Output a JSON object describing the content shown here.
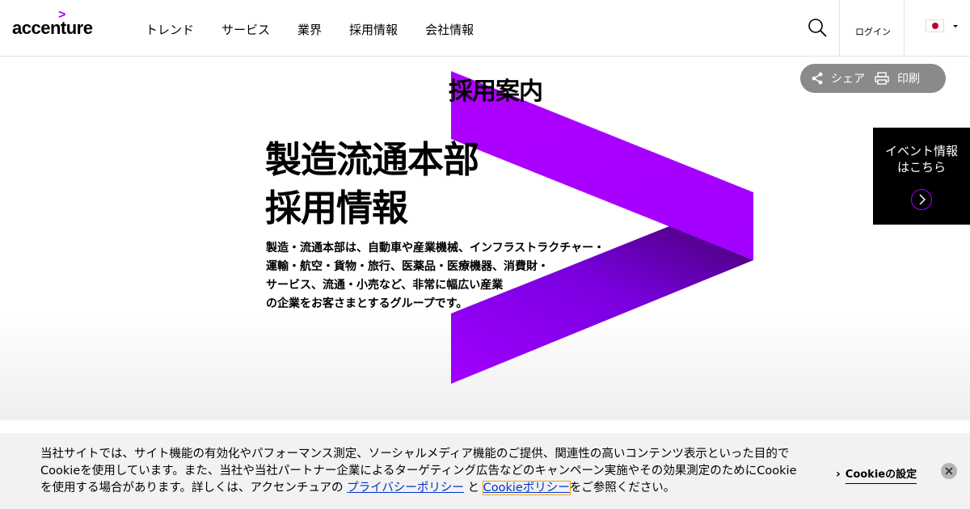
{
  "header": {
    "logo_text": "accenture",
    "logo_mark": ">",
    "nav": [
      "トレンド",
      "サービス",
      "業界",
      "採用情報",
      "会社情報"
    ],
    "login_label": "ログイン"
  },
  "hero": {
    "page_title": "採用案内",
    "heading_line1": "製造流通本部",
    "heading_line2": "採用情報",
    "body_lines": [
      "製造・流通本部は、自動車や産業機械、インフラストラクチャー・",
      "運輸・航空・貨物・旅行、医薬品・医療機器、消費財・",
      "サービス、流通・小売など、非常に幅広い産業",
      "の企業をお客さまとするグループです。"
    ]
  },
  "share_bar": {
    "share_label": "シェア",
    "print_label": "印刷"
  },
  "event": {
    "line1": "イベント情報",
    "line2": "はこちら"
  },
  "cookie": {
    "text_before": "当社サイトでは、サイト機能の有効化やパフォーマンス測定、ソーシャルメディア機能のご提供、関連性の高いコンテンツ表示といった目的でCookieを使用しています。また、当社や当社パートナー企業によるターゲティング広告などのキャンペーン実施やその効果測定のためにCookieを使用する場合があります。詳しくは、アクセンチュアの ",
    "privacy_link": "プライバシーポリシー",
    "text_and": " と ",
    "cookie_link": "Cookieポリシー",
    "text_after": "をご参照ください。",
    "settings_label": "Cookieの設定"
  },
  "colors": {
    "accent": "#a100ff",
    "accent_dark": "#460073",
    "banner_bg": "#f2f2f2",
    "event_bg": "#000000",
    "share_bg": "#8a8a8a"
  }
}
